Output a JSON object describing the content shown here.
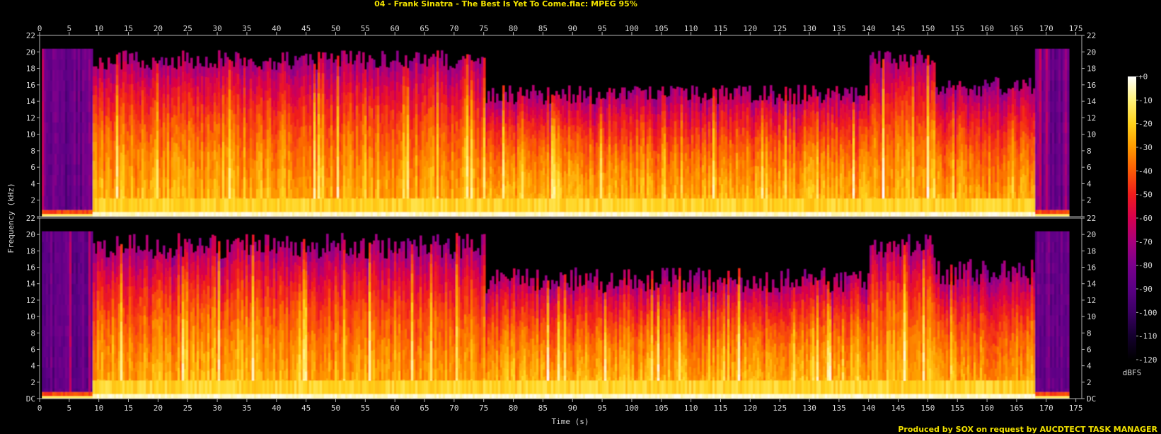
{
  "chart_data": {
    "type": "heatmap",
    "title": "04 - Frank Sinatra - The Best Is Yet To Come.flac: MPEG 95%",
    "xlabel": "Time (s)",
    "ylabel": "Frequency (kHz)",
    "xlim": [
      0,
      176
    ],
    "ylim": [
      0,
      22
    ],
    "x_ticks": [
      0,
      5,
      10,
      15,
      20,
      25,
      30,
      35,
      40,
      45,
      50,
      55,
      60,
      65,
      70,
      75,
      80,
      85,
      90,
      95,
      100,
      105,
      110,
      115,
      120,
      125,
      130,
      135,
      140,
      145,
      150,
      155,
      160,
      165,
      170,
      175
    ],
    "y_ticks": [
      "DC",
      "2",
      "4",
      "6",
      "8",
      "10",
      "12",
      "14",
      "16",
      "18",
      "20",
      "22"
    ],
    "channels": 2,
    "colorbar": {
      "label": "dBFS",
      "ticks": [
        "+0",
        "-10",
        "-20",
        "-30",
        "-40",
        "-50",
        "-60",
        "-70",
        "-80",
        "-90",
        "-100",
        "-110",
        "-120"
      ],
      "range": [
        -120,
        0
      ]
    },
    "segments": [
      {
        "t0": 0.3,
        "t1": 8.8,
        "top_khz": 20.4,
        "level": 0.28,
        "label": "intro low-level noise band"
      },
      {
        "t0": 8.8,
        "t1": 40,
        "top_khz": 20.2,
        "level": 0.62
      },
      {
        "t0": 40,
        "t1": 75,
        "top_khz": 20.2,
        "level": 0.6
      },
      {
        "t0": 75,
        "t1": 140,
        "top_khz": 16.0,
        "level": 0.62
      },
      {
        "t0": 140,
        "t1": 151,
        "top_khz": 20.2,
        "level": 0.62
      },
      {
        "t0": 151,
        "t1": 168,
        "top_khz": 17.0,
        "level": 0.6
      },
      {
        "t0": 168,
        "t1": 173.5,
        "top_khz": 20.4,
        "level": 0.3,
        "label": "outro low-level noise band"
      }
    ]
  },
  "footer": {
    "credit": "Produced by SOX on request by AUCDTECT TASK MANAGER"
  },
  "colors": {
    "background": "#000000",
    "title": "#f2e200",
    "axis": "#c8c8c8",
    "palette": [
      "#000000",
      "#14002e",
      "#3a0062",
      "#5a0084",
      "#7a008c",
      "#a8007c",
      "#d6004e",
      "#f01c1c",
      "#fb5a06",
      "#fe9a00",
      "#ffd21c",
      "#fff27a",
      "#ffffff"
    ]
  }
}
